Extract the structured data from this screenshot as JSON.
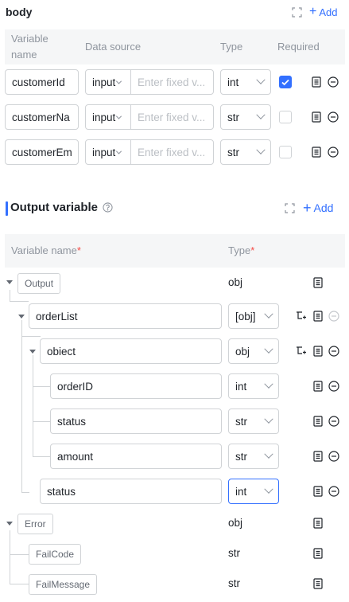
{
  "body_section": {
    "title": "body",
    "add_label": "Add",
    "columns": {
      "variable_name": "Variable name",
      "data_source": "Data source",
      "type": "Type",
      "required": "Required"
    },
    "rows": [
      {
        "name": "customerId",
        "source": "input",
        "placeholder": "Enter fixed v...",
        "type": "int",
        "required": true
      },
      {
        "name": "customerNa",
        "source": "input",
        "placeholder": "Enter fixed v...",
        "type": "str",
        "required": false
      },
      {
        "name": "customerEm",
        "source": "input",
        "placeholder": "Enter fixed v...",
        "type": "str",
        "required": false
      }
    ]
  },
  "output_section": {
    "title": "Output variable",
    "add_label": "Add",
    "columns": {
      "variable_name": "Variable name",
      "type": "Type",
      "required_mark": "*"
    },
    "tree": {
      "output": {
        "label": "Output",
        "type": "obj"
      },
      "order_list": {
        "name": "orderList",
        "type": "[obj]"
      },
      "object": {
        "name": "obiect",
        "type": "obj"
      },
      "order_id": {
        "name": "orderID",
        "type": "int"
      },
      "status_inner": {
        "name": "status",
        "type": "str"
      },
      "amount": {
        "name": "amount",
        "type": "str"
      },
      "status_outer": {
        "name": "status",
        "type": "int"
      },
      "error": {
        "label": "Error",
        "type": "obj"
      },
      "fail_code": {
        "label": "FailCode",
        "type": "str"
      },
      "fail_message": {
        "label": "FailMessage",
        "type": "str"
      }
    }
  },
  "colors": {
    "accent": "#3370ff",
    "required": "#f54a45",
    "border": "#d0d3d6",
    "muted": "#8f959e"
  }
}
